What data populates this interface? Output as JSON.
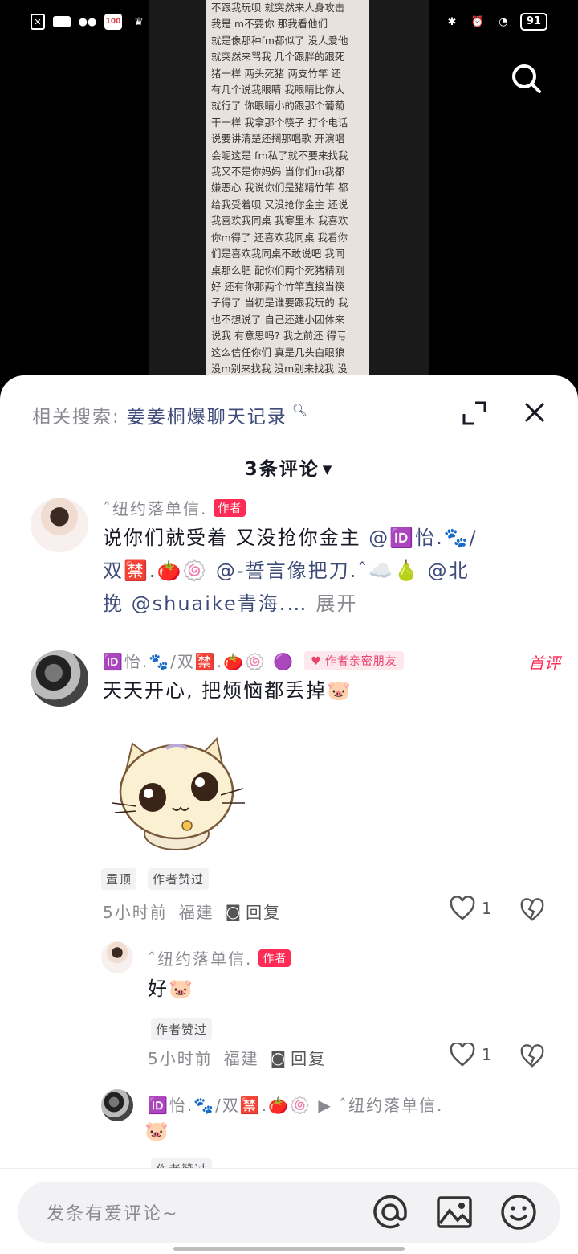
{
  "status_bar": {
    "battery": "91"
  },
  "background_doc": {
    "lines": [
      "不跟我玩呗 就突然来人身攻击",
      "我是 m不要你 那我看他们",
      "就是像那种fm都似了 没人爱他",
      "就突然来骂我 几个跟胖的跟死",
      "猪一样 两头死猪 两支竹竿 还",
      "有几个说我眼睛 我眼睛比你大",
      "就行了 你眼睛小的跟那个葡萄",
      "干一样 我拿那个筷子 打个电话",
      "说要讲清楚还搁那唱歌 开演唱",
      "会呢这是 fm私了就不要来找我",
      "我又不是你妈妈 当你们m我都",
      "嫌恶心 我说你们是猪精竹竿 都",
      "给我受着呗 又没抢你金主 还说",
      "我喜欢我同桌 我寒里木 我喜欢",
      "你m得了 还喜欢我同桌 我看你",
      "们是喜欢我同桌不敢说吧 我同",
      "桌那么肥 配你们两个死猪精刚",
      "好 还有你那两个竹竿直接当筷",
      "子得了 当初是谁要跟我玩的 我",
      "也不想说了 自己还建小团体来",
      "说我 有意思吗? 我之前还 得亏",
      "这么信任你们 真是几头白眼狼",
      "没m别来找我 没m别来找我 没"
    ]
  },
  "sheet": {
    "related_label": "相关搜索:",
    "related_query": "姜姜桐爆聊天记录",
    "comment_count_label": "3条评论"
  },
  "comments": [
    {
      "username": "ˆ纽约落单信.",
      "tag": "作者",
      "text_plain_1": "说你们就受着 又没抢你金主 ",
      "mention_1": "@🆔怡.🐾/",
      "mention_2": "双🈲.🍅🍥 @-誓言像把刀.ˆ☁️🍐 @北",
      "mention_3": "挽 @shuaike青海.…",
      "expand": "展开"
    },
    {
      "username": "🆔怡.🐾/双🈲.🍅🍥 🟣",
      "tag": "作者亲密朋友",
      "first": "首评",
      "text": "天天开心, 把烦恼都丢掉🐷",
      "chip_pin": "置顶",
      "chip_liked": "作者赞过",
      "time": "5小时前",
      "location": "福建",
      "reply": "回复",
      "likes": "1"
    }
  ],
  "reply": {
    "username": "ˆ纽约落单信.",
    "tag": "作者",
    "text": "好🐷",
    "chip_liked": "作者赞过",
    "time": "5小时前",
    "location": "福建",
    "reply": "回复",
    "likes": "1"
  },
  "reply2": {
    "username": "🆔怡.🐾/双🈲.🍅🍥 ▶ ˆ纽约落单信.",
    "text": "🐷",
    "chip_liked": "作者赞过"
  },
  "input": {
    "placeholder": "发条有爱评论~"
  },
  "colors": {
    "accent": "#fe2c55",
    "mention": "#3f4c7a",
    "muted": "#8a8b91"
  }
}
